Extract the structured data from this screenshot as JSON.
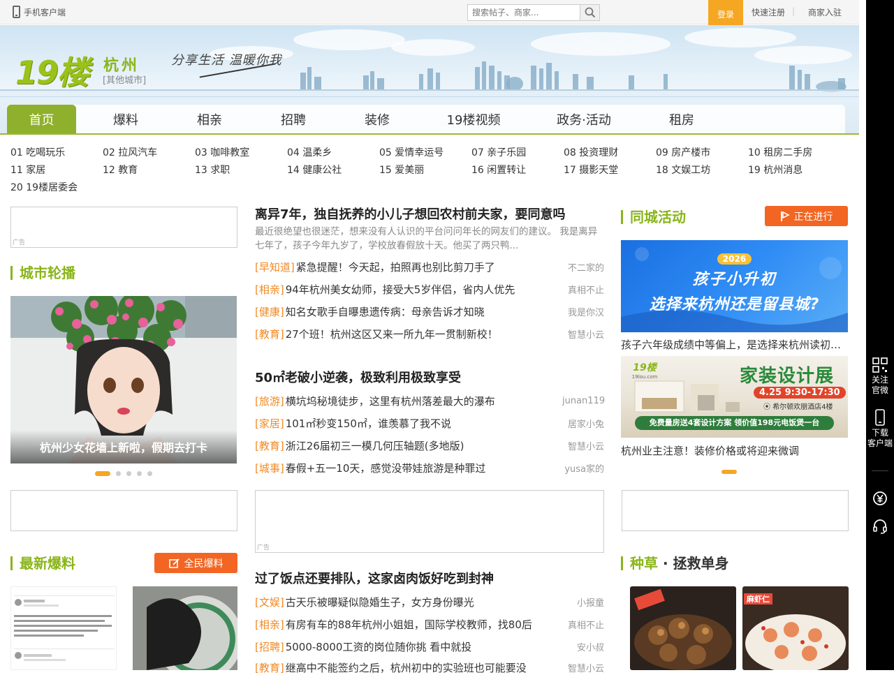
{
  "topbar": {
    "mobile_client": "手机客户端",
    "search_placeholder": "搜索帖子、商家...",
    "login": "登录",
    "register": "快速注册",
    "merchant": "商家入驻"
  },
  "header": {
    "logo": "19楼",
    "city": "杭州",
    "other_cities": "[其他城市]",
    "slogan": "分享生活 温暖你我"
  },
  "nav": [
    "首页",
    "爆料",
    "相亲",
    "招聘",
    "装修",
    "19楼视频",
    "政务·活动",
    "租房"
  ],
  "subcats": [
    "01 吃喝玩乐",
    "02 拉风汽车",
    "03 咖啡教室",
    "04 温柔乡",
    "05 爱情幸运号",
    "07 亲子乐园",
    "08 投资理财",
    "09 房产楼市",
    "10 租房二手房",
    "11 家居",
    "12 教育",
    "13 求职",
    "14 健康公社",
    "15 爱美丽",
    "16 闲置转让",
    "17 摄影天堂",
    "18 文娱工坊",
    "19 杭州消息",
    "20 19楼居委会"
  ],
  "ad_label": "广告",
  "left": {
    "city_carousel_title": "城市轮播",
    "carousel_caption": "杭州少女花墙上新啦，假期去打卡",
    "latest_title": "最新爆料",
    "latest_button": "全民爆料"
  },
  "middle": {
    "block1": {
      "headline": "离异7年，独自抚养的小儿子想回农村前夫家，要同意吗",
      "summary": "最近很绝望也很迷茫，想来没有人认识的平台问问年长的网友们的建议。 我是离异七年了，孩子今年九岁了，学校放春假放十天。他买了两只鸭...",
      "items": [
        {
          "cat": "[早知道]",
          "title": "紧急提醒！今天起，拍照再也别比剪刀手了",
          "author": "不二家的"
        },
        {
          "cat": "[相亲]",
          "title": "94年杭州美女幼师，接受大5岁伴侣，省内人优先",
          "author": "真相不止"
        },
        {
          "cat": "[健康]",
          "title": "知名女歌手自曝患遗传病：母亲告诉才知晓",
          "author": "我是你汉"
        },
        {
          "cat": "[教育]",
          "title": "27个班！杭州这区又来一所九年一贯制新校！",
          "author": "智慧小云"
        }
      ]
    },
    "block2": {
      "headline": "50㎡老破小逆袭，极致利用极致享受",
      "items": [
        {
          "cat": "[旅游]",
          "title": "横坑坞秘境徒步，这里有杭州落差最大的瀑布",
          "author": "junan119"
        },
        {
          "cat": "[家居]",
          "title": "101㎡秒变150㎡，谁羡慕了我不说",
          "author": "居家小兔"
        },
        {
          "cat": "[教育]",
          "title": "浙江26届初三一模几何压轴题(多地版)",
          "author": "智慧小云"
        },
        {
          "cat": "[城事]",
          "title": "春假+五一10天，感觉没带娃旅游是种罪过",
          "author": "yusa家的"
        }
      ]
    },
    "block3": {
      "headline": "过了饭点还要排队，这家卤肉饭好吃到封神",
      "items": [
        {
          "cat": "[文娱]",
          "title": "古天乐被曝疑似隐婚生子，女方身份曝光",
          "author": "小报童"
        },
        {
          "cat": "[相亲]",
          "title": "有房有车的88年杭州小姐姐，国际学校教师，找80后",
          "author": "真相不止"
        },
        {
          "cat": "[招聘]",
          "title": "5000-8000工资的岗位随你挑 看中就投",
          "author": "安小叔"
        },
        {
          "cat": "[教育]",
          "title": "继高中不能签约之后，杭州初中的实验班也可能要没",
          "author": "智慧小云"
        }
      ]
    }
  },
  "right": {
    "activity_title": "同城活动",
    "activity_button": "正在进行",
    "promo1": {
      "year": "2026",
      "line1": "孩子小升初",
      "line2": "选择来杭州还是留县城?",
      "caption": "孩子六年级成绩中等偏上，是选择来杭州读初中还是留县城"
    },
    "promo2": {
      "logo": "19楼",
      "logo_sub": "19lou.com",
      "title": "家装设计展",
      "date": "4.25 9:30-17:30",
      "venue": "希尔顿欢朋酒店4楼",
      "offer": "免费量房送4套设计方案  领价值198元电饭煲一台",
      "caption": "杭州业主注意！装修价格或将迎来微调"
    },
    "grass_title_a": "种草",
    "grass_sep": "·",
    "grass_title_b": "拯救单身",
    "food_tag1": "",
    "food_tag2": "麻虾仁"
  },
  "floatbar": {
    "follow": [
      "关注",
      "官微"
    ],
    "download": [
      "下载",
      "客户端"
    ]
  },
  "colors": {
    "accent": "#8ab51a",
    "orange": "#f26522",
    "login": "#f5a623",
    "category": "#f08a24"
  },
  "carousel": {
    "slides": 5,
    "active_slide": 1
  }
}
